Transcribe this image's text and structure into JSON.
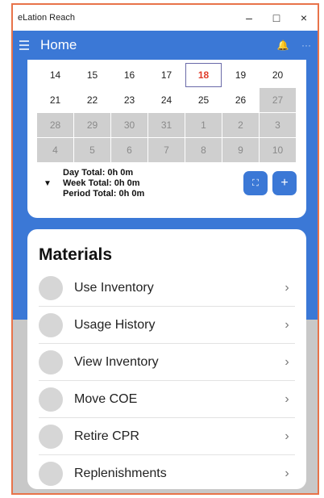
{
  "window": {
    "title": "eLation Reach",
    "minimize": "–",
    "maximize": "□",
    "close": "×"
  },
  "appbar": {
    "title": "Home",
    "bell": "🔔",
    "more": "···"
  },
  "calendar": {
    "today": "18",
    "weeks": [
      [
        {
          "d": "14",
          "g": false
        },
        {
          "d": "15",
          "g": false
        },
        {
          "d": "16",
          "g": false
        },
        {
          "d": "17",
          "g": false
        },
        {
          "d": "18",
          "g": false,
          "t": true
        },
        {
          "d": "19",
          "g": false
        },
        {
          "d": "20",
          "g": false
        }
      ],
      [
        {
          "d": "21",
          "g": false
        },
        {
          "d": "22",
          "g": false
        },
        {
          "d": "23",
          "g": false
        },
        {
          "d": "24",
          "g": false
        },
        {
          "d": "25",
          "g": false
        },
        {
          "d": "26",
          "g": false
        },
        {
          "d": "27",
          "g": true
        }
      ],
      [
        {
          "d": "28",
          "g": true
        },
        {
          "d": "29",
          "g": true
        },
        {
          "d": "30",
          "g": true
        },
        {
          "d": "31",
          "g": true
        },
        {
          "d": "1",
          "g": true
        },
        {
          "d": "2",
          "g": true
        },
        {
          "d": "3",
          "g": true
        }
      ],
      [
        {
          "d": "4",
          "g": true
        },
        {
          "d": "5",
          "g": true
        },
        {
          "d": "6",
          "g": true
        },
        {
          "d": "7",
          "g": true
        },
        {
          "d": "8",
          "g": true
        },
        {
          "d": "9",
          "g": true
        },
        {
          "d": "10",
          "g": true
        }
      ]
    ]
  },
  "totals": {
    "caret": "▼",
    "day": "Day Total: 0h 0m",
    "week": "Week Total: 0h 0m",
    "period": "Period Total: 0h 0m"
  },
  "buttons": {
    "expand": "⛶",
    "add": "+"
  },
  "materials": {
    "title": "Materials",
    "chevron": "›",
    "items": [
      {
        "label": "Use Inventory"
      },
      {
        "label": "Usage History"
      },
      {
        "label": "View Inventory"
      },
      {
        "label": "Move COE"
      },
      {
        "label": "Retire CPR"
      },
      {
        "label": "Replenishments"
      }
    ]
  },
  "colors": {
    "accent": "#3b78d6",
    "today": "#e03c2a",
    "window_border": "#e8734a"
  }
}
